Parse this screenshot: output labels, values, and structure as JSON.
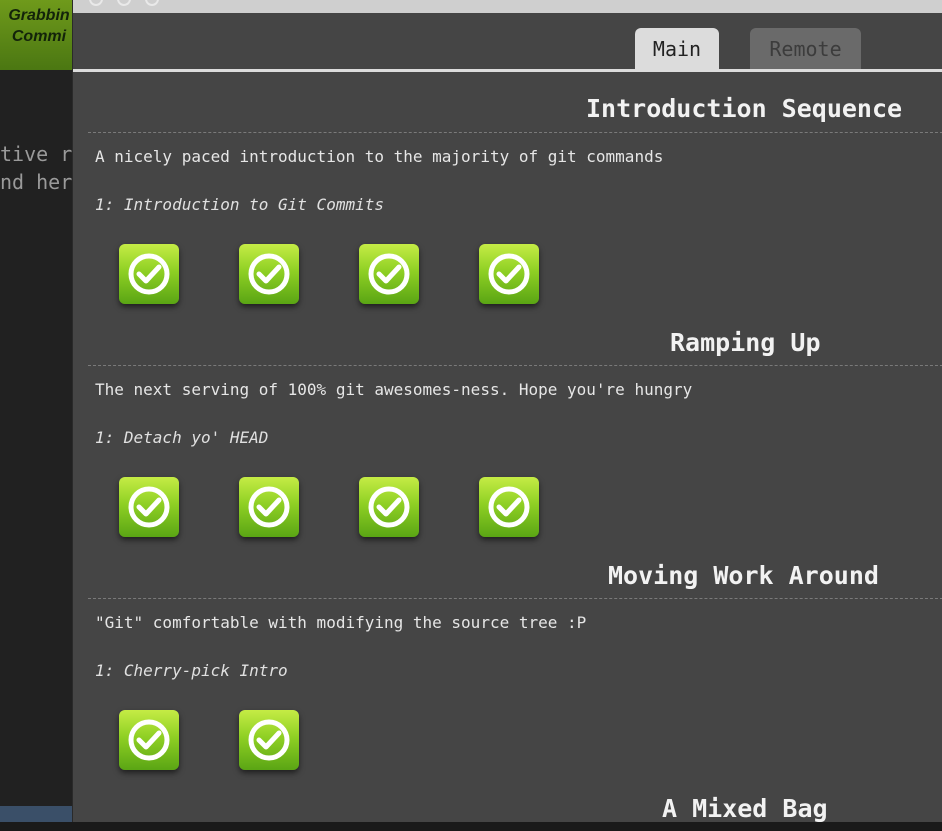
{
  "background_app": {
    "badge_lines": [
      "Grabbin",
      "Commi"
    ],
    "text_lines": [
      "tive r",
      "nd her"
    ]
  },
  "tabs": {
    "main_label": "Main",
    "remote_label": "Remote"
  },
  "sections": [
    {
      "title": "Introduction Sequence",
      "description": "A nicely paced introduction to the majority of git commands",
      "sequence_label": "1: Introduction to Git Commits",
      "levels_completed": 4
    },
    {
      "title": "Ramping Up",
      "description": "The next serving of 100% git awesomes-ness. Hope you're hungry",
      "sequence_label": "1: Detach yo' HEAD",
      "levels_completed": 4
    },
    {
      "title": "Moving Work Around",
      "description": "\"Git\" comfortable with modifying the source tree :P",
      "sequence_label": "1: Cherry-pick Intro",
      "levels_completed": 2
    },
    {
      "title": "A Mixed Bag"
    }
  ],
  "colors": {
    "level_green_top": "#c5ec45",
    "level_green_bottom": "#5aa514",
    "panel_bg": "#454545"
  }
}
